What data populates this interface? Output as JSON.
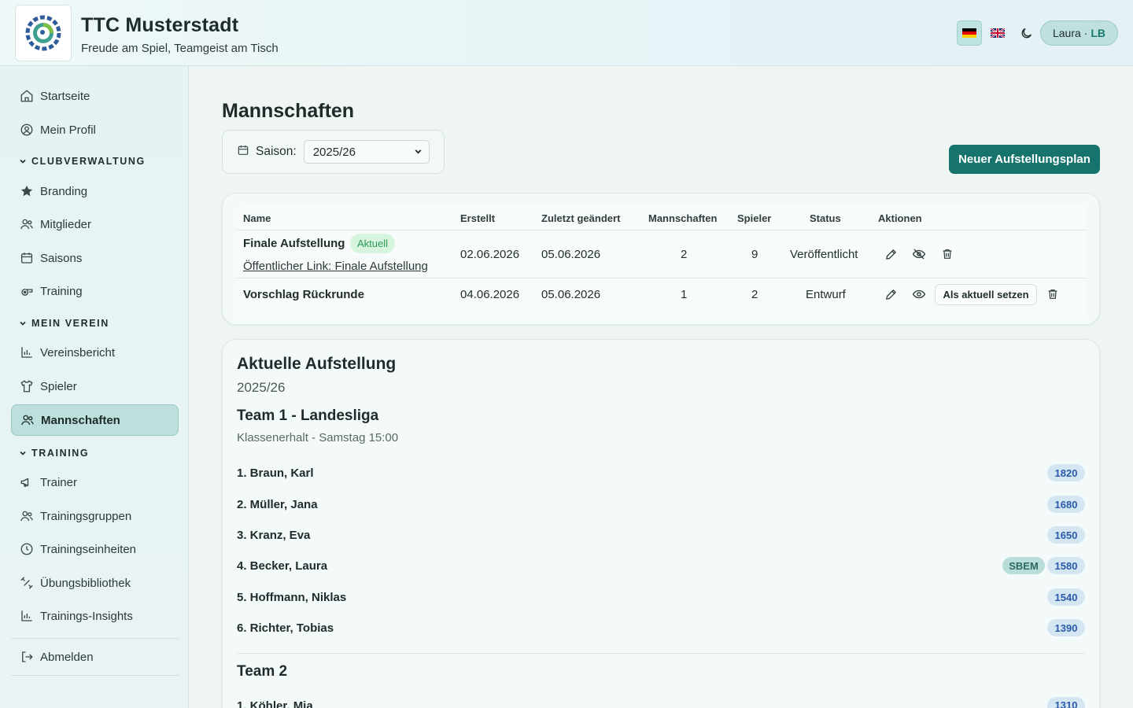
{
  "header": {
    "club_name": "TTC Musterstadt",
    "tagline": "Freude am Spiel, Teamgeist am Tisch",
    "user_name": "Laura ·",
    "user_initials": "LB",
    "lang_de_icon": "flag-de-icon",
    "lang_en_icon": "flag-uk-icon",
    "theme_icon": "moon-icon"
  },
  "sidebar": {
    "items_top": [
      {
        "label": "Startseite",
        "icon": "home-icon"
      },
      {
        "label": "Mein Profil",
        "icon": "user-circle-icon"
      }
    ],
    "sections": [
      {
        "title": "CLUBVERWALTUNG",
        "items": [
          {
            "label": "Branding",
            "icon": "star-icon"
          },
          {
            "label": "Mitglieder",
            "icon": "users-icon"
          },
          {
            "label": "Saisons",
            "icon": "calendar-icon"
          },
          {
            "label": "Training",
            "icon": "whistle-icon"
          }
        ]
      },
      {
        "title": "MEIN VEREIN",
        "items": [
          {
            "label": "Vereinsbericht",
            "icon": "bar-chart-icon"
          },
          {
            "label": "Spieler",
            "icon": "shirt-icon"
          },
          {
            "label": "Mannschaften",
            "icon": "users-icon",
            "active": true
          }
        ]
      },
      {
        "title": "TRAINING",
        "items": [
          {
            "label": "Trainer",
            "icon": "megaphone-icon"
          },
          {
            "label": "Trainingsgruppen",
            "icon": "users-icon"
          },
          {
            "label": "Trainingseinheiten",
            "icon": "clock-icon"
          },
          {
            "label": "Übungsbibliothek",
            "icon": "dumbbell-icon"
          },
          {
            "label": "Trainings-Insights",
            "icon": "bar-chart-icon"
          }
        ]
      }
    ],
    "logout": {
      "label": "Abmelden",
      "icon": "logout-icon"
    }
  },
  "main": {
    "title": "Mannschaften",
    "season_label": "Saison:",
    "season_value": "2025/26",
    "new_plan_label": "Neuer Aufstellungsplan",
    "table": {
      "columns": [
        "Name",
        "Erstellt",
        "Zuletzt geändert",
        "Mannschaften",
        "Spieler",
        "Status",
        "Aktionen"
      ],
      "rows": [
        {
          "name": "Finale Aufstellung",
          "badge": "Aktuell",
          "link": "Öffentlicher Link: Finale Aufstellung",
          "created": "02.06.2026",
          "modified": "05.06.2026",
          "teams": "2",
          "players": "9",
          "status": "Veröffentlicht"
        },
        {
          "name": "Vorschlag Rückrunde",
          "created": "04.06.2026",
          "modified": "05.06.2026",
          "teams": "1",
          "players": "2",
          "status": "Entwurf",
          "action_label": "Als aktuell setzen"
        }
      ]
    },
    "lineup": {
      "title": "Aktuelle Aufstellung",
      "season": "2025/26",
      "teams": [
        {
          "name": "Team 1 - Landesliga",
          "subtitle": "Klassenerhalt - Samstag 15:00",
          "players": [
            {
              "label": "1. Braun, Karl",
              "rating": "1820"
            },
            {
              "label": "2. Müller, Jana",
              "rating": "1680"
            },
            {
              "label": "3. Kranz, Eva",
              "rating": "1650"
            },
            {
              "label": "4. Becker, Laura",
              "rating": "1580",
              "tag": "SBEM"
            },
            {
              "label": "5. Hoffmann, Niklas",
              "rating": "1540"
            },
            {
              "label": "6. Richter, Tobias",
              "rating": "1390"
            }
          ]
        },
        {
          "name": "Team 2",
          "players": [
            {
              "label": "1. Köhler, Mia",
              "rating": "1310"
            }
          ]
        }
      ]
    }
  },
  "colors": {
    "accent": "#16746c",
    "active_bg": "#bde0dd",
    "rating_bg": "#d5e6f3",
    "rating_fg": "#2a5aa8",
    "badge_green": "#2e9a55"
  }
}
